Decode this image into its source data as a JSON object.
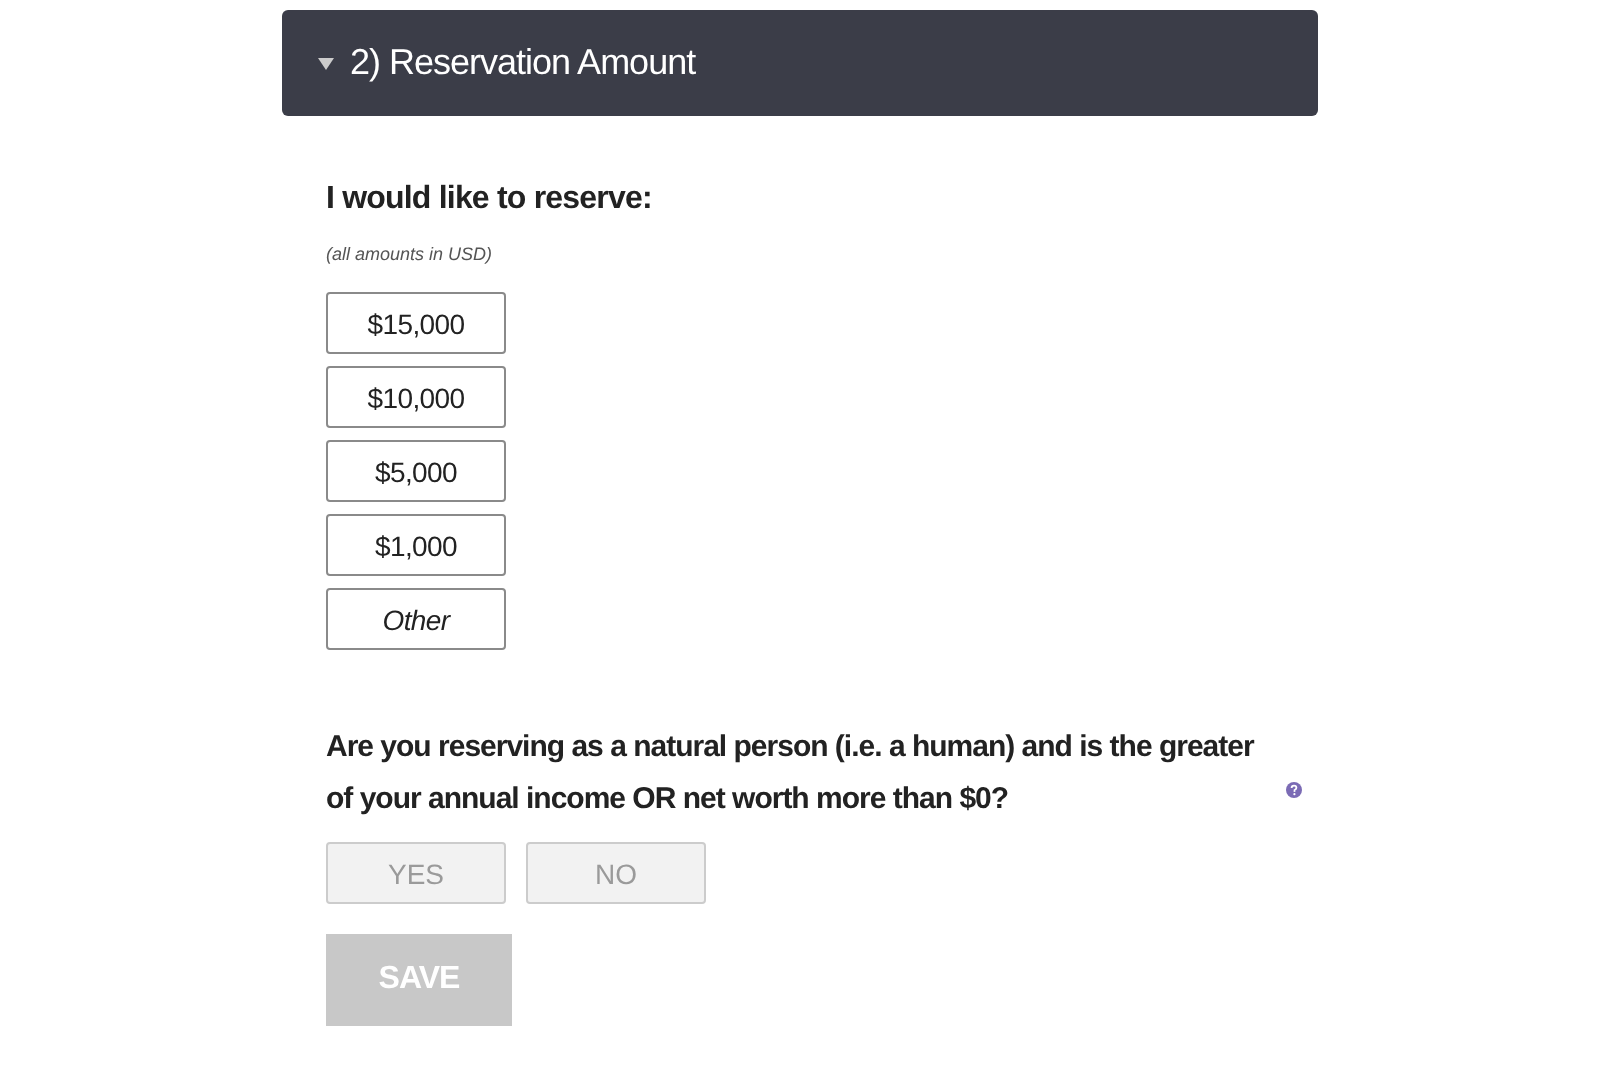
{
  "section": {
    "title": "2) Reservation Amount",
    "expanded": true
  },
  "amount_prompt": "I would like to reserve:",
  "amount_note": "(all amounts in USD)",
  "amounts": [
    {
      "label": "$15,000",
      "kind": "amount",
      "selected": false
    },
    {
      "label": "$10,000",
      "kind": "amount",
      "selected": false
    },
    {
      "label": "$5,000",
      "kind": "amount",
      "selected": false
    },
    {
      "label": "$1,000",
      "kind": "amount",
      "selected": false
    },
    {
      "label": "Other",
      "kind": "other",
      "selected": false
    }
  ],
  "question": "Are you reserving as a natural person (i.e. a human) and is the greater of your annual income OR net worth more than $0?",
  "answers": [
    {
      "label": "YES",
      "disabled": true,
      "selected": false
    },
    {
      "label": "NO",
      "disabled": true,
      "selected": false
    }
  ],
  "save_button": {
    "label": "SAVE",
    "disabled": true
  }
}
